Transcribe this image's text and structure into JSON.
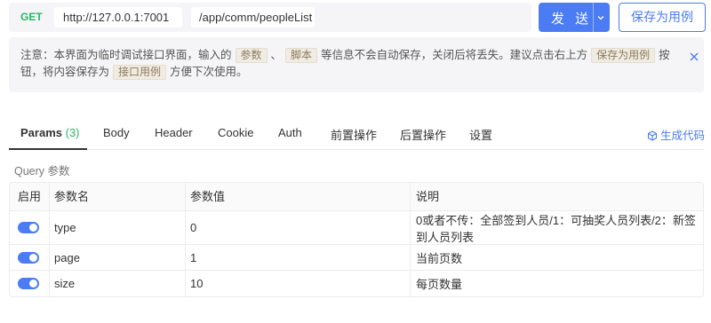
{
  "request": {
    "method": "GET",
    "host": "http://127.0.0.1:7001",
    "path": "/app/comm/peopleList",
    "send_label": "发 送",
    "save_label": "保存为用例"
  },
  "notice": {
    "part1": "注意：本界面为临时调试接口界面，输入的",
    "tag_params": "参数",
    "sep": "、",
    "tag_script": "脚本",
    "part2": "等信息不会自动保存，关闭后将丢失。建议点击右上方",
    "tag_save": "保存为用例",
    "part3": "按钮，将内容保存为",
    "tag_case": "接口用例",
    "part4": "方便下次使用。"
  },
  "tabs": {
    "params": "Params",
    "params_count": "(3)",
    "body": "Body",
    "header": "Header",
    "cookie": "Cookie",
    "auth": "Auth",
    "pre": "前置操作",
    "post": "后置操作",
    "settings": "设置",
    "gen_code": "生成代码"
  },
  "query_title": "Query 参数",
  "table": {
    "headers": {
      "enabled": "启用",
      "name": "参数名",
      "value": "参数值",
      "desc": "说明"
    },
    "rows": [
      {
        "enabled": true,
        "name": "type",
        "value": "0",
        "desc": "0或者不传：全部签到人员/1：可抽奖人员列表/2：新签到人员列表"
      },
      {
        "enabled": true,
        "name": "page",
        "value": "1",
        "desc": "当前页数"
      },
      {
        "enabled": true,
        "name": "size",
        "value": "10",
        "desc": "每页数量"
      }
    ]
  },
  "colors": {
    "accent": "#4b7cf3",
    "method_green": "#2db56a"
  }
}
